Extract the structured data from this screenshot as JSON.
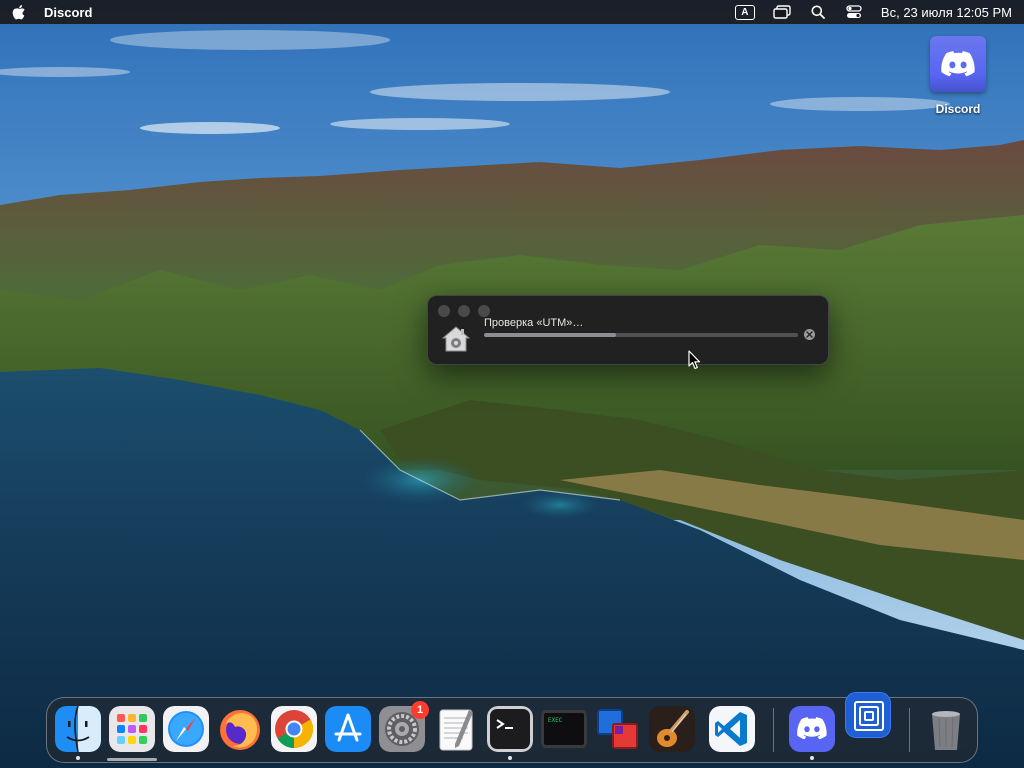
{
  "menubar": {
    "app_name": "Discord",
    "keyboard_layout": "A",
    "clock": "Вс, 23 июля  12:05 PM",
    "icons": [
      "apple-icon",
      "keyboard-layout-icon",
      "mission-control-icon",
      "spotlight-search-icon",
      "control-center-icon"
    ]
  },
  "desktop": {
    "icons": [
      {
        "label": "Discord",
        "icon": "discord-icon"
      }
    ]
  },
  "dialog": {
    "message": "Проверка «UTM»…",
    "progress": 0.42,
    "icon": "document-house-icon"
  },
  "dock": {
    "apps": [
      {
        "name": "Finder",
        "icon": "finder-icon",
        "running": true
      },
      {
        "name": "Launchpad",
        "icon": "launchpad-icon",
        "running": false
      },
      {
        "name": "Safari",
        "icon": "safari-icon",
        "running": false
      },
      {
        "name": "Firefox",
        "icon": "firefox-icon",
        "running": false
      },
      {
        "name": "Chrome",
        "icon": "chrome-icon",
        "running": false
      },
      {
        "name": "App Store",
        "icon": "app-store-icon",
        "running": false
      },
      {
        "name": "System Preferences",
        "icon": "system-preferences-icon",
        "badge": "1",
        "running": false
      },
      {
        "name": "TextEdit",
        "icon": "textedit-icon",
        "running": false
      },
      {
        "name": "Terminal",
        "icon": "terminal-icon",
        "running": true
      },
      {
        "name": "Exec",
        "icon": "exec-console-icon",
        "label": "EXEC",
        "running": false
      },
      {
        "name": "Remote Desktop",
        "icon": "remote-desktop-icon",
        "running": false
      },
      {
        "name": "GarageBand",
        "icon": "garageband-icon",
        "running": false
      },
      {
        "name": "VS Code",
        "icon": "vscode-icon",
        "running": false
      },
      {
        "name": "Discord",
        "icon": "discord-icon",
        "running": true
      },
      {
        "name": "UTM",
        "icon": "utm-icon",
        "running": false
      },
      {
        "name": "Trash",
        "icon": "trash-icon",
        "running": false
      }
    ]
  },
  "colors": {
    "discord": "#5865f2",
    "badge": "#ff3b30",
    "menubar": "#19191c"
  }
}
